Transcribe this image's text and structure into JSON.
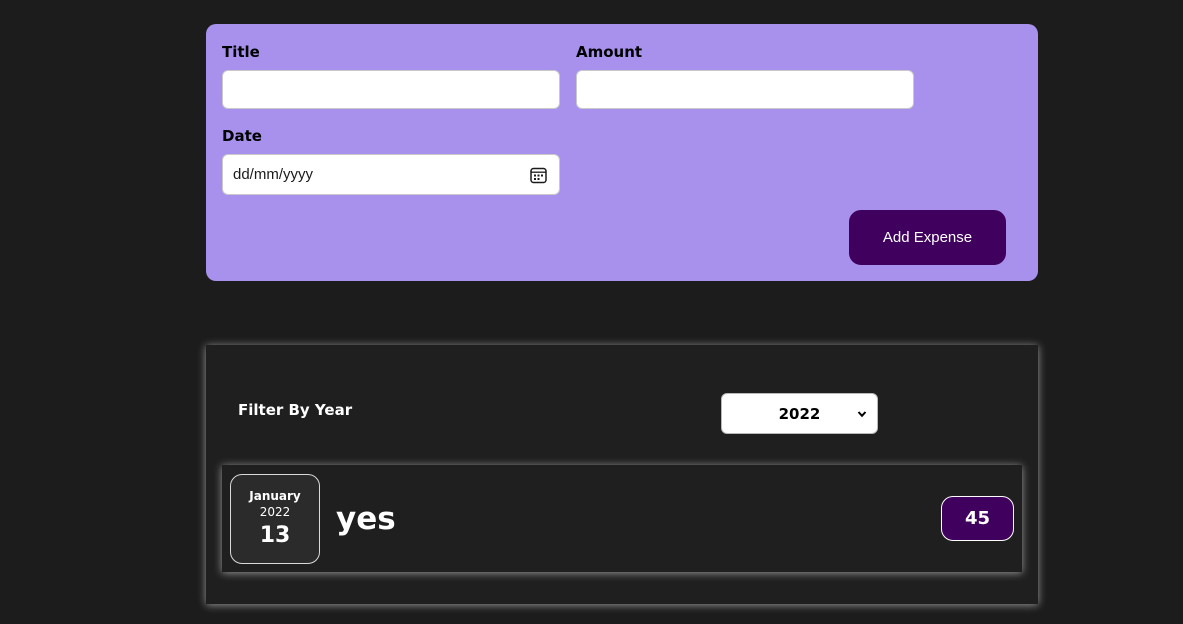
{
  "form": {
    "title_label": "Title",
    "title_value": "",
    "amount_label": "Amount",
    "amount_value": "",
    "date_label": "Date",
    "date_placeholder": "dd/mm/yyyy",
    "date_icon": "calendar-icon",
    "submit_label": "Add Expense",
    "background_color": "#a891ec",
    "button_color": "#40005d"
  },
  "filter": {
    "label": "Filter By Year",
    "selected_year": "2022",
    "dropdown_icon": "chevron-down-icon"
  },
  "expenses": [
    {
      "month": "January",
      "year": "2022",
      "day": "13",
      "title": "yes",
      "amount": "45"
    }
  ],
  "colors": {
    "page_background": "#1c1c1c",
    "panel_background": "#1f1f1f",
    "accent": "#40005d"
  }
}
